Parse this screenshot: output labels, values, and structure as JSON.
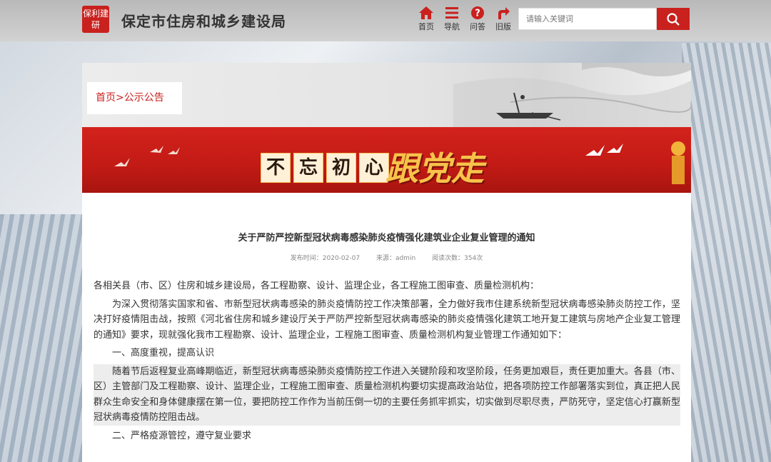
{
  "header": {
    "logo_text": "保利建研",
    "site_title": "保定市住房和城乡建设局",
    "nav": [
      {
        "label": "首页",
        "icon": "home-icon"
      },
      {
        "label": "导航",
        "icon": "menu-icon"
      },
      {
        "label": "问答",
        "icon": "question-icon"
      },
      {
        "label": "旧版",
        "icon": "share-arrow-icon"
      }
    ],
    "search": {
      "placeholder": "请输入关键词"
    }
  },
  "breadcrumb": {
    "home": "首页",
    "separator": ">",
    "current": "公示公告"
  },
  "banner": {
    "chars": [
      "不",
      "忘",
      "初",
      "心"
    ],
    "slogan": "跟党走"
  },
  "article": {
    "title": "关于严防严控新型冠状病毒感染肺炎疫情强化建筑业企业复业管理的通知",
    "meta": {
      "published": "发布时间：2020-02-07",
      "source": "来源：admin",
      "views": "阅读次数：354次"
    },
    "paragraphs": [
      "各相关县（市、区）住房和城乡建设局，各工程勘察、设计、监理企业，各工程施工图审查、质量检测机构：",
      "为深入贯彻落实国家和省、市新型冠状病毒感染的肺炎疫情防控工作决策部署，全力做好我市住建系统新型冠状病毒感染肺炎防控工作，坚决打好疫情阻击战，按照《河北省住房和城乡建设厅关于严防严控新型冠状病毒感染的肺炎疫情强化建筑工地开复工建筑与房地产企业复工管理的通知》要求，现就强化我市工程勘察、设计、监理企业，工程施工图审查、质量检测机构复业管理工作通知如下：",
      "一、高度重视，提高认识",
      "随着节后返程复业高峰期临近，新型冠状病毒感染肺炎疫情防控工作进入关键阶段和攻坚阶段，任务更加艰巨，责任更加重大。各县（市、区）主管部门及工程勘察、设计、监理企业，工程施工图审查、质量检测机构要切实提高政治站位，把各项防控工作部署落实到位，真正把人民群众生命安全和身体健康摆在第一位，要把防控工作作为当前压倒一切的主要任务抓牢抓实，切实做到尽职尽责，严防死守，坚定信心打赢新型冠状病毒疫情防控阻击战。",
      "二、严格疫源管控，遵守复业要求"
    ]
  },
  "colors": {
    "accent": "#c9211e",
    "banner_gold": "#f7c24a"
  }
}
